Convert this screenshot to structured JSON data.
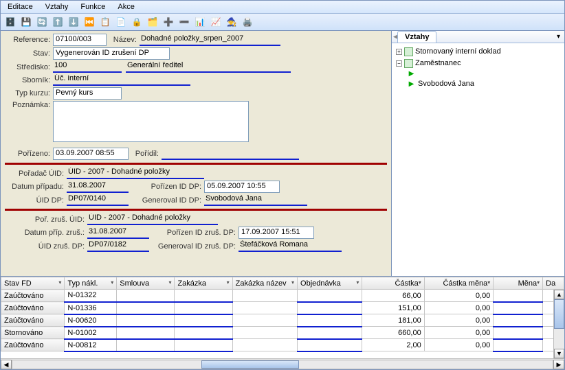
{
  "menu": {
    "editace": "Editace",
    "vztahy": "Vztahy",
    "funkce": "Funkce",
    "akce": "Akce"
  },
  "form": {
    "reference_lbl": "Reference:",
    "reference": "07100/003",
    "nazev_lbl": "Název:",
    "nazev": "Dohadné položky_srpen_2007",
    "stav_lbl": "Stav:",
    "stav": "Vygenerován ID zrušení DP",
    "stredisko_lbl": "Středisko:",
    "stredisko_code": "100",
    "stredisko_name": "Generální ředitel",
    "sbornik_lbl": "Sborník:",
    "sbornik": "Úč. interní",
    "typkurzu_lbl": "Typ kurzu:",
    "typkurzu": "Pevný kurs",
    "poznamka_lbl": "Poznámka:",
    "porizeno_lbl": "Pořízeno:",
    "porizeno": "03.09.2007 08:55",
    "poridil_lbl": "Pořídil:",
    "poridil": "",
    "poradac_uid_lbl": "Pořadač ÚID:",
    "poradac_uid": "ÚID - 2007 - Dohadné položky",
    "datum_pripadu_lbl": "Datum případu:",
    "datum_pripadu": "31.08.2007",
    "porizen_iddp_lbl": "Pořízen ID DP:",
    "porizen_iddp": "05.09.2007 10:55",
    "uid_dp_lbl": "ÚID DP:",
    "uid_dp": "DP07/0140",
    "generoval_iddp_lbl": "Generoval ID DP:",
    "generoval_iddp": "Svobodová Jana",
    "por_zrus_uid_lbl": "Poř. zruš. ÚID:",
    "por_zrus_uid": "ÚID - 2007 - Dohadné položky",
    "datum_prip_zrus_lbl": "Datum příp. zruš.:",
    "datum_prip_zrus": "31.08.2007",
    "porizen_idzrus_lbl": "Pořízen ID zruš. DP:",
    "porizen_idzrus": "17.09.2007 15:51",
    "uid_zrus_dp_lbl": "ÚID zruš. DP:",
    "uid_zrus_dp": "DP07/0182",
    "generoval_idzrus_lbl": "Generoval ID zruš. DP:",
    "generoval_idzrus": "Štefáčková Romana"
  },
  "right": {
    "tab": "Vztahy",
    "n1": "Stornovaný interní doklad",
    "n2": "Zaměstnanec",
    "n3": "Svobodová Jana"
  },
  "grid": {
    "cols": {
      "stav": "Stav FD",
      "typ": "Typ nákl.",
      "sml": "Smlouva",
      "zak": "Zakázka",
      "zakn": "Zakázka název",
      "obj": "Objednávka",
      "cast": "Částka",
      "cm": "Částka měna",
      "men": "Měna",
      "da": "Da"
    },
    "rows": [
      {
        "stav": "Zaúčtováno",
        "typ": "N-01322",
        "cast": "66,00",
        "cm": "0,00"
      },
      {
        "stav": "Zaúčtováno",
        "typ": "N-01336",
        "cast": "151,00",
        "cm": "0,00"
      },
      {
        "stav": "Zaúčtováno",
        "typ": "N-00620",
        "cast": "181,00",
        "cm": "0,00"
      },
      {
        "stav": "Stornováno",
        "typ": "N-01002",
        "cast": "660,00",
        "cm": "0,00"
      },
      {
        "stav": "Zaúčtováno",
        "typ": "N-00812",
        "cast": "2,00",
        "cm": "0,00"
      }
    ]
  }
}
